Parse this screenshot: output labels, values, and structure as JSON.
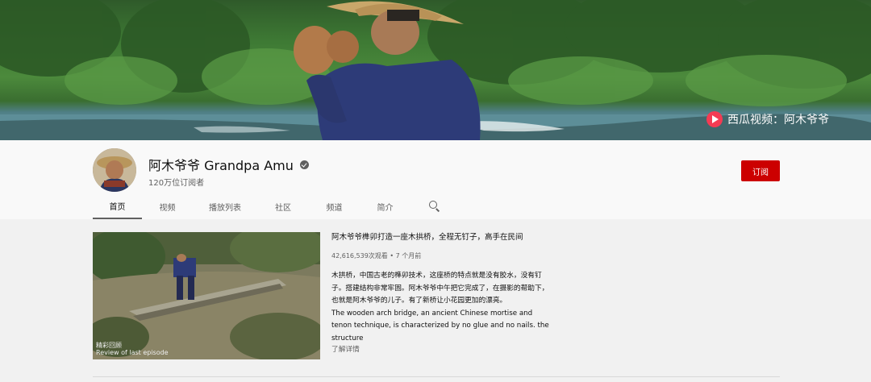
{
  "banner": {
    "watermark_text": "西瓜视频：阿木爷爷",
    "watermark_color": "#f43b53"
  },
  "channel": {
    "name": "阿木爷爷 Grandpa Amu",
    "subscribers": "120万位订阅者",
    "subscribe_label": "订阅",
    "subscribe_color": "#cc0000"
  },
  "tabs": [
    {
      "label": "首页",
      "active": true
    },
    {
      "label": "视频"
    },
    {
      "label": "播放列表"
    },
    {
      "label": "社区"
    },
    {
      "label": "频道"
    },
    {
      "label": "简介"
    }
  ],
  "search_icon": "search-icon",
  "featured": {
    "thumb_caption_1": "精彩回顾",
    "thumb_caption_2": "Review of last episode",
    "title": "阿木爷爷榫卯打造一座木拱桥，全程无钉子，高手在民间",
    "meta": "42,616,539次观看 • 7 个月前",
    "desc_zh": "木拱桥，中国古老的榫卯技术，这座桥的特点就是没有胶水，没有钉子。搭建结构非常牢固。阿木爷爷中午把它完成了，在摄影的帮助下，也就是阿木爷爷的儿子。有了新桥让小花园更加的漂亮。",
    "desc_en": "The wooden arch bridge, an ancient Chinese mortise and tenon technique, is characterized by no glue and no nails. the structure",
    "read_more": "了解详情"
  }
}
